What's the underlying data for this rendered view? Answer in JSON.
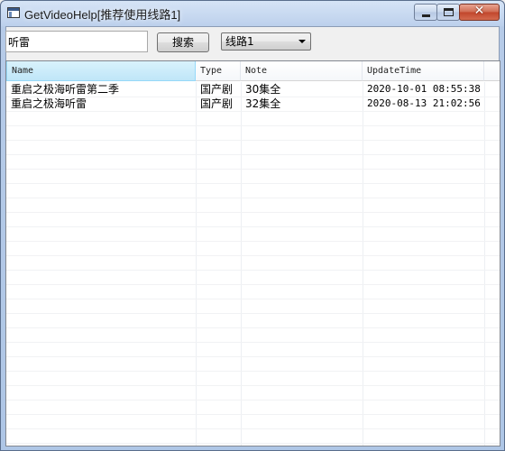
{
  "window": {
    "title": "GetVideoHelp[推荐使用线路1]",
    "minimize_icon": "minimize-icon",
    "maximize_icon": "maximize-icon",
    "close_icon": "close-icon",
    "close_glyph": "✕"
  },
  "search": {
    "value": "听雷",
    "button_label": "搜索"
  },
  "route": {
    "selected": "线路1"
  },
  "table": {
    "columns": [
      "Name",
      "Type",
      "Note",
      "UpdateTime"
    ],
    "rows": [
      {
        "name": "重启之极海听雷第二季",
        "type": "国产剧",
        "note": "30集全",
        "time": "2020-10-01 08:55:38"
      },
      {
        "name": "重启之极海听雷",
        "type": "国产剧",
        "note": "32集全",
        "time": "2020-08-13 21:02:56"
      }
    ]
  }
}
